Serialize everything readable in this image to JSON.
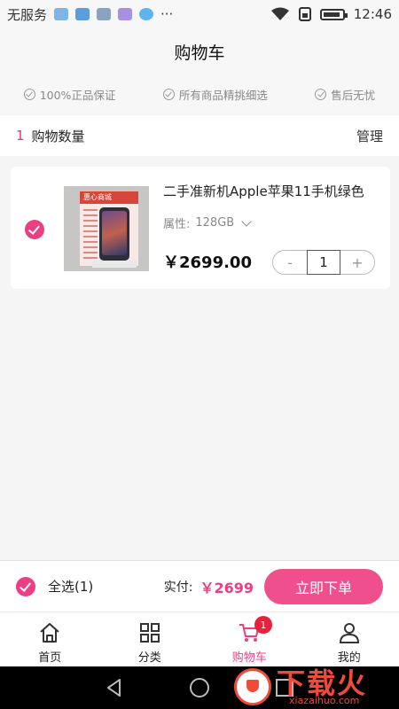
{
  "status_bar": {
    "carrier": "无服务",
    "more": "···",
    "time": "12:46"
  },
  "header": {
    "title": "购物车"
  },
  "guarantees": [
    {
      "label": "100%正品保证"
    },
    {
      "label": "所有商品精挑细选"
    },
    {
      "label": "售后无忧"
    }
  ],
  "cart_summary": {
    "count": "1",
    "count_label": "购物数量",
    "manage_label": "管理"
  },
  "cart_items": [
    {
      "title": "二手准新机Apple苹果11手机绿色",
      "image_brand": "惠心商城",
      "attr_label": "属性:",
      "attr_value": "128GB",
      "price": "￥2699.00",
      "quantity": "1",
      "minus": "-",
      "plus": "+"
    }
  ],
  "checkout": {
    "select_all_label": "全选(1)",
    "paid_label": "实付:",
    "paid_amount": "￥2699",
    "order_button": "立即下单"
  },
  "tabs": [
    {
      "label": "首页",
      "icon": "home-icon"
    },
    {
      "label": "分类",
      "icon": "grid-icon"
    },
    {
      "label": "购物车",
      "icon": "cart-icon",
      "badge": "1",
      "active": true
    },
    {
      "label": "我的",
      "icon": "user-icon"
    }
  ],
  "watermark": {
    "text": "下载火",
    "sub": "xiazaihuo.com"
  },
  "colors": {
    "accent": "#ec3f83",
    "badge": "#e8223a",
    "watermark": "#ef4a3a"
  }
}
